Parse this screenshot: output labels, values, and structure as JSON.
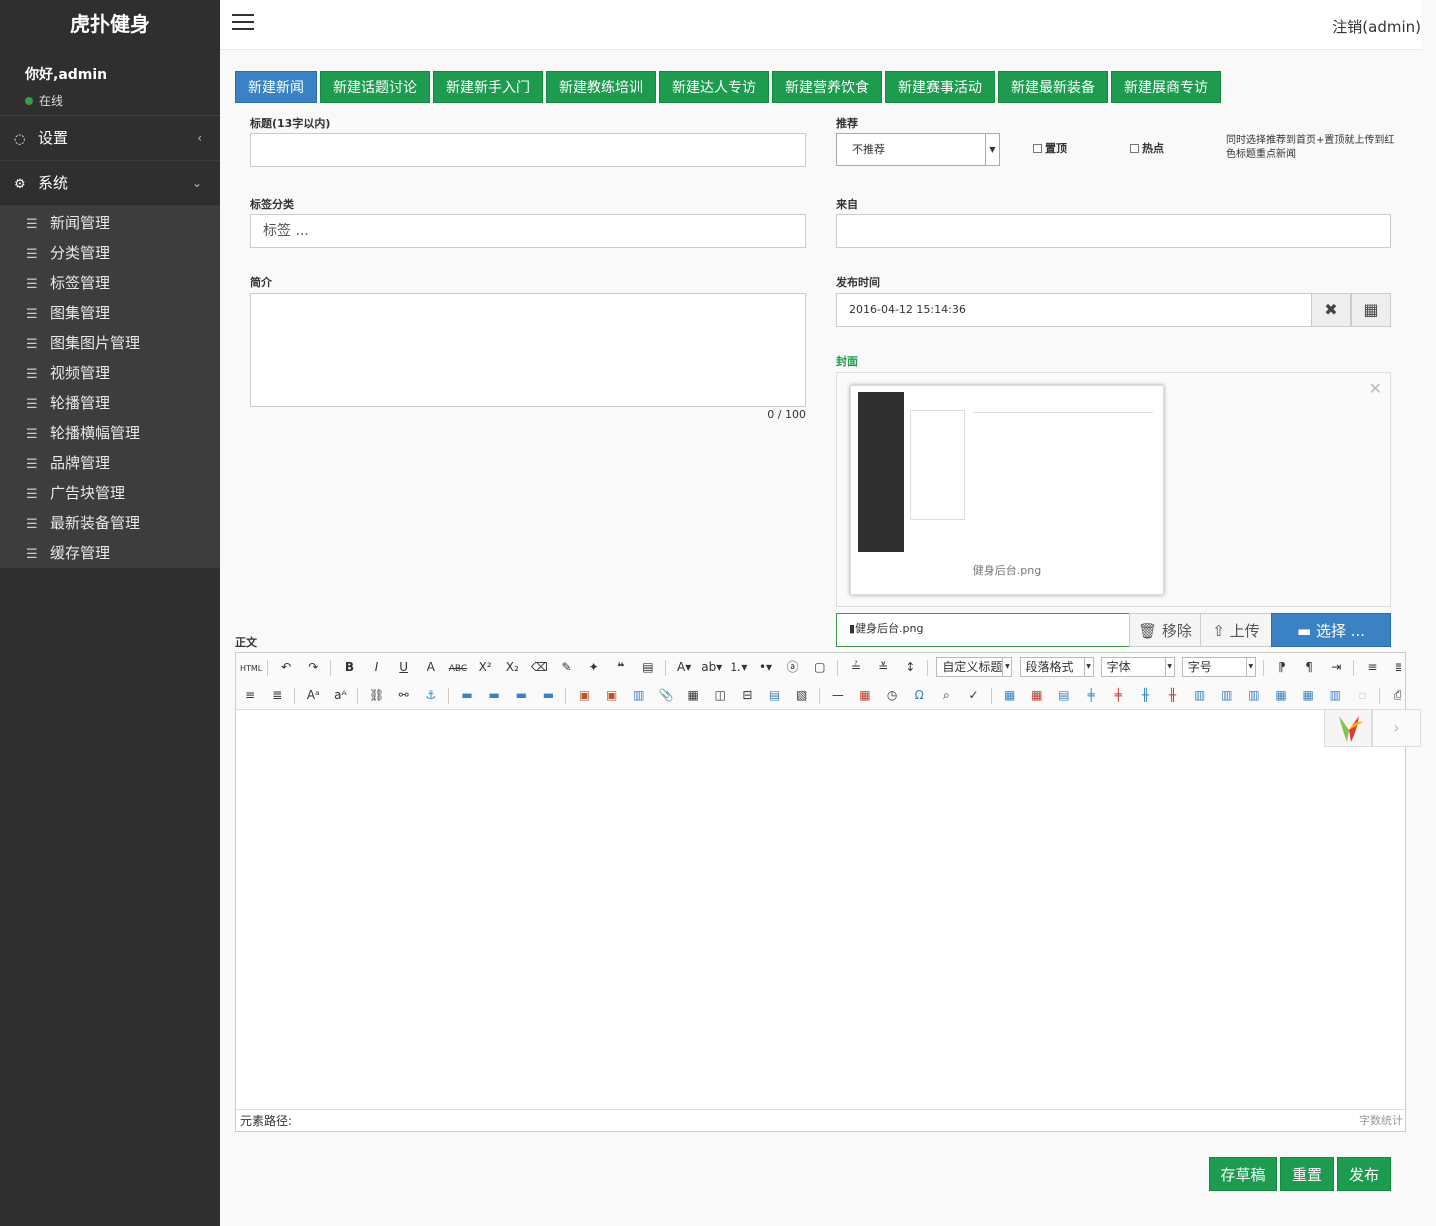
{
  "brand": "虎扑健身",
  "user": {
    "greeting": "你好,admin",
    "status": "在线"
  },
  "menu": {
    "settings": "设置",
    "system": "系统",
    "items": [
      "新闻管理",
      "分类管理",
      "标签管理",
      "图集管理",
      "图集图片管理",
      "视频管理",
      "轮播管理",
      "轮播横幅管理",
      "品牌管理",
      "广告块管理",
      "最新装备管理",
      "缓存管理"
    ]
  },
  "topbar": {
    "logout": "注销(admin)"
  },
  "tabs": [
    "新建新闻",
    "新建话题讨论",
    "新建新手入门",
    "新建教练培训",
    "新建达人专访",
    "新建营养饮食",
    "新建赛事活动",
    "新建最新装备",
    "新建展商专访"
  ],
  "form": {
    "title_label": "标题(13字以内)",
    "title_value": "",
    "recommend_label": "推荐",
    "recommend_value": "不推荐",
    "top_label": "置顶",
    "hot_label": "热点",
    "hint": "同时选择推荐到首页+置顶就上传到红色标题重点新闻",
    "tags_label": "标签分类",
    "tags_placeholder": "标签 ...",
    "source_label": "来自",
    "source_value": "",
    "intro_label": "简介",
    "intro_value": "",
    "intro_count": "0 / 100",
    "pubtime_label": "发布时间",
    "pubtime_value": "2016-04-12 15:14:36",
    "cover_label": "封面",
    "cover_filename": "健身后台.png",
    "file_input": "健身后台.png",
    "remove_label": "移除",
    "upload_label": "上传",
    "choose_label": "选择 ...",
    "body_label": "正文"
  },
  "editor": {
    "custom_title": "自定义标题",
    "paragraph": "段落格式",
    "font": "字体",
    "size": "字号",
    "path_label": "元素路径:",
    "word_count": "字数统计"
  },
  "actions": {
    "draft": "存草稿",
    "reset": "重置",
    "publish": "发布"
  },
  "colors": {
    "sidebar": "#2f2f2f",
    "green": "#1d9b4f",
    "blue": "#3a82c4"
  }
}
